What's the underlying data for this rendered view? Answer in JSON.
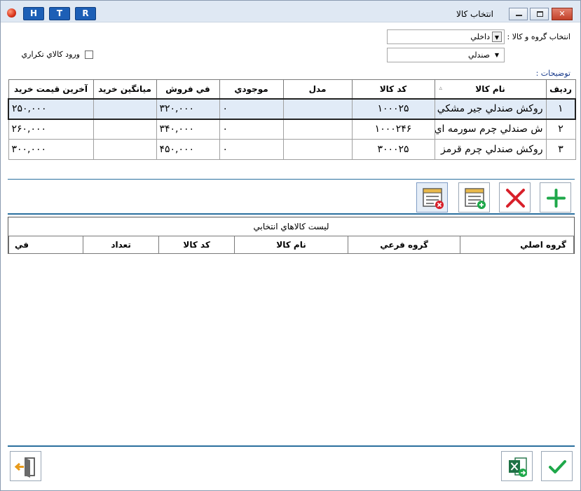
{
  "window": {
    "title": "انتخاب كالا",
    "htr_buttons": [
      "H",
      "T",
      "R"
    ],
    "close_glyph": "✕"
  },
  "filters": {
    "group_label": "انتخاب گروه و كالا :",
    "group_value": "داخلي",
    "product_value": "صندلي",
    "duplicate_label": "ورود كالاي تكراري",
    "duplicate_checked": false,
    "notes_label": "توضيحات :"
  },
  "products_table": {
    "columns": [
      "رديف",
      "نام كالا",
      "كد كالا",
      "مدل",
      "موجودي",
      "في فروش",
      "ميانگين خريد",
      "آخرين قيمت خريد"
    ],
    "sort_indicator": "▵",
    "rows": [
      {
        "row": "۱",
        "name": "روكش صندلي جير مشكي",
        "code": "۱۰۰۰۲۵",
        "model": "",
        "stock": "۰",
        "price": "۳۲۰,۰۰۰",
        "avg": "",
        "last": "۲۵۰,۰۰۰",
        "selected": true
      },
      {
        "row": "۲",
        "name": "ش صندلي چرم سورمه اي",
        "code": "۱۰۰۰۲۴۶",
        "model": "",
        "stock": "۰",
        "price": "۳۴۰,۰۰۰",
        "avg": "",
        "last": "۲۶۰,۰۰۰",
        "selected": false
      },
      {
        "row": "۳",
        "name": "روكش صندلي چرم قرمز",
        "code": "۳۰۰۰۲۵",
        "model": "",
        "stock": "۰",
        "price": "۴۵۰,۰۰۰",
        "avg": "",
        "last": "۳۰۰,۰۰۰",
        "selected": false
      }
    ]
  },
  "toolbar": {
    "buttons": [
      "add-icon",
      "delete-icon",
      "add-all-icon",
      "remove-all-icon"
    ]
  },
  "selected_list": {
    "caption": "ليست كالاهاي انتخابي",
    "columns": [
      "گروه اصلي",
      "گروه فرعي",
      "نام كالا",
      "كد كالا",
      "تعداد",
      "في"
    ]
  },
  "footer": {
    "buttons": [
      "exit-icon",
      "excel-icon",
      "confirm-icon"
    ]
  },
  "colors": {
    "titlebar": "#dfe8f3",
    "accent_line": "#2a6f9e",
    "selected_row": "#e1ebf7",
    "add_green": "#1fa84a",
    "delete_red": "#d8202a"
  }
}
